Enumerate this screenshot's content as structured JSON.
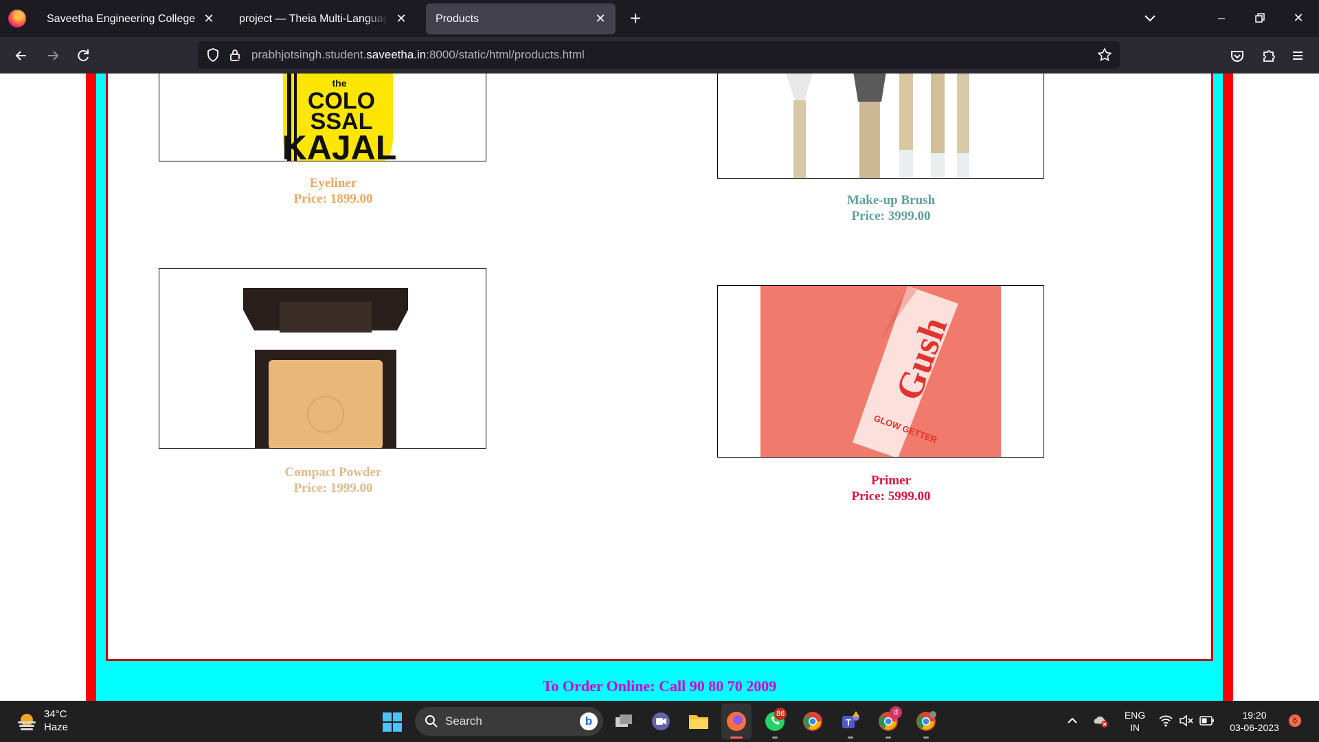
{
  "browser": {
    "tabs": [
      {
        "label": "Saveetha Engineering College",
        "active": false
      },
      {
        "label": "project — Theia Multi-Language Example",
        "active": false
      },
      {
        "label": "Products",
        "active": true
      }
    ],
    "url": {
      "prefix": "prabhjotsingh.student.",
      "host": "saveetha.in",
      "suffix": ":8000/static/html/products.html"
    }
  },
  "products": [
    {
      "name": "Eyeliner",
      "price": "Price: 1899.00",
      "color": "#f0a55e",
      "image_text": [
        "the",
        "COLO",
        "SSAL",
        "KAJAL"
      ]
    },
    {
      "name": "Make-up Brush",
      "price": "Price: 3999.00",
      "color": "#5f9ea0"
    },
    {
      "name": "Compact Powder",
      "price": "Price: 1999.00",
      "color": "#e2b98a"
    },
    {
      "name": "Primer",
      "price": "Price: 5999.00",
      "color": "#dc143c",
      "image_text": [
        "Gush",
        "GLOW GETTER"
      ]
    }
  ],
  "footer": {
    "text": "To Order Online: Call 90 80 70 2009"
  },
  "taskbar": {
    "weather": {
      "temp": "34°C",
      "condition": "Haze"
    },
    "search_label": "Search",
    "badges": {
      "whatsapp": "86",
      "chrome_profile": "d",
      "notifications": "6"
    },
    "lang": {
      "line1": "ENG",
      "line2": "IN"
    },
    "clock": {
      "time": "19:20",
      "date": "03-06-2023"
    }
  }
}
